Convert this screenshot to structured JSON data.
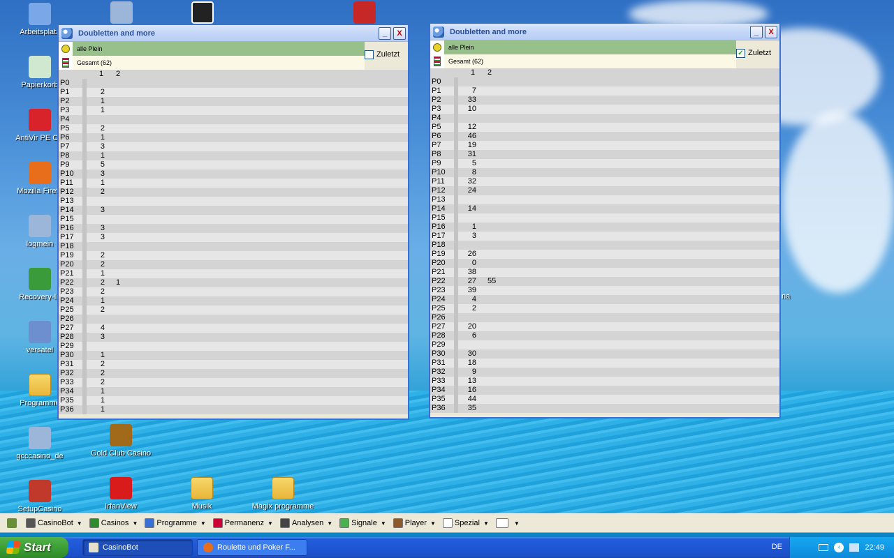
{
  "desktop": {
    "icons_left": [
      {
        "label": "Arbeitsplatz",
        "color": "#7aa7e8"
      },
      {
        "label": "Papierkorb",
        "color": "#cfe8cf"
      },
      {
        "label": "AntiVir PE Cla",
        "color": "#d8232a"
      },
      {
        "label": "Mozilla Firefo",
        "color": "#e86e1c"
      },
      {
        "label": "logmein",
        "color": "#9bb6d8"
      },
      {
        "label": "Recovery-In",
        "color": "#3a9b3a"
      },
      {
        "label": "versatel",
        "color": "#6d8fd0"
      },
      {
        "label": "Programme",
        "color": "folder"
      },
      {
        "label": "gcccasino_de",
        "color": "#9bb6d8"
      },
      {
        "label": "SetupCasino",
        "color": "#c0392b"
      }
    ],
    "icons_bottom": [
      {
        "label": "Gold Club Casino",
        "color": "#a06a1a"
      },
      {
        "label": "IrfanView",
        "color": "#d91b1b"
      },
      {
        "label": "Musik",
        "color": "folder"
      },
      {
        "label": "Magix programme",
        "color": "folder"
      }
    ],
    "stray_label": "na"
  },
  "window_left": {
    "title": "Doubletten and more",
    "filter_label": "alle Plein",
    "total_label": "Gesamt  (62)",
    "checkbox_label": "Zuletzt",
    "checkbox_checked": false,
    "col_headers": [
      "1",
      "2"
    ],
    "rows": [
      [
        "P0",
        "",
        ""
      ],
      [
        "P1",
        "2",
        ""
      ],
      [
        "P2",
        "1",
        ""
      ],
      [
        "P3",
        "1",
        ""
      ],
      [
        "P4",
        "",
        ""
      ],
      [
        "P5",
        "2",
        ""
      ],
      [
        "P6",
        "1",
        ""
      ],
      [
        "P7",
        "3",
        ""
      ],
      [
        "P8",
        "1",
        ""
      ],
      [
        "P9",
        "5",
        ""
      ],
      [
        "P10",
        "3",
        ""
      ],
      [
        "P11",
        "1",
        ""
      ],
      [
        "P12",
        "2",
        ""
      ],
      [
        "P13",
        "",
        ""
      ],
      [
        "P14",
        "3",
        ""
      ],
      [
        "P15",
        "",
        ""
      ],
      [
        "P16",
        "3",
        ""
      ],
      [
        "P17",
        "3",
        ""
      ],
      [
        "P18",
        "",
        ""
      ],
      [
        "P19",
        "2",
        ""
      ],
      [
        "P20",
        "2",
        ""
      ],
      [
        "P21",
        "1",
        ""
      ],
      [
        "P22",
        "2",
        "1"
      ],
      [
        "P23",
        "2",
        ""
      ],
      [
        "P24",
        "1",
        ""
      ],
      [
        "P25",
        "2",
        ""
      ],
      [
        "P26",
        "",
        ""
      ],
      [
        "P27",
        "4",
        ""
      ],
      [
        "P28",
        "3",
        ""
      ],
      [
        "P29",
        "",
        ""
      ],
      [
        "P30",
        "1",
        ""
      ],
      [
        "P31",
        "2",
        ""
      ],
      [
        "P32",
        "2",
        ""
      ],
      [
        "P33",
        "2",
        ""
      ],
      [
        "P34",
        "1",
        ""
      ],
      [
        "P35",
        "1",
        ""
      ],
      [
        "P36",
        "1",
        ""
      ]
    ]
  },
  "window_right": {
    "title": "Doubletten and more",
    "filter_label": "alle Plein",
    "total_label": "Gesamt  (62)",
    "checkbox_label": "Zuletzt",
    "checkbox_checked": true,
    "col_headers": [
      "1",
      "2"
    ],
    "rows": [
      [
        "P0",
        "",
        ""
      ],
      [
        "P1",
        "7",
        ""
      ],
      [
        "P2",
        "33",
        ""
      ],
      [
        "P3",
        "10",
        ""
      ],
      [
        "P4",
        "",
        ""
      ],
      [
        "P5",
        "12",
        ""
      ],
      [
        "P6",
        "46",
        ""
      ],
      [
        "P7",
        "19",
        ""
      ],
      [
        "P8",
        "31",
        ""
      ],
      [
        "P9",
        "5",
        ""
      ],
      [
        "P10",
        "8",
        ""
      ],
      [
        "P11",
        "32",
        ""
      ],
      [
        "P12",
        "24",
        ""
      ],
      [
        "P13",
        "",
        ""
      ],
      [
        "P14",
        "14",
        ""
      ],
      [
        "P15",
        "",
        ""
      ],
      [
        "P16",
        "1",
        ""
      ],
      [
        "P17",
        "3",
        ""
      ],
      [
        "P18",
        "",
        ""
      ],
      [
        "P19",
        "26",
        ""
      ],
      [
        "P20",
        "0",
        ""
      ],
      [
        "P21",
        "38",
        ""
      ],
      [
        "P22",
        "27",
        "55"
      ],
      [
        "P23",
        "39",
        ""
      ],
      [
        "P24",
        "4",
        ""
      ],
      [
        "P25",
        "2",
        ""
      ],
      [
        "P26",
        "",
        ""
      ],
      [
        "P27",
        "20",
        ""
      ],
      [
        "P28",
        "6",
        ""
      ],
      [
        "P29",
        "",
        ""
      ],
      [
        "P30",
        "30",
        ""
      ],
      [
        "P31",
        "18",
        ""
      ],
      [
        "P32",
        "9",
        ""
      ],
      [
        "P33",
        "13",
        ""
      ],
      [
        "P34",
        "16",
        ""
      ],
      [
        "P35",
        "44",
        ""
      ],
      [
        "P36",
        "35",
        ""
      ]
    ]
  },
  "casinobot_bar": {
    "items": [
      {
        "label": "CasinoBot",
        "icon": "casinobot-icon"
      },
      {
        "label": "Casinos",
        "icon": "dollar-icon"
      },
      {
        "label": "Programme",
        "icon": "window-icon"
      },
      {
        "label": "Permanenz",
        "icon": "stack-icon"
      },
      {
        "label": "Analysen",
        "icon": "chart-icon"
      },
      {
        "label": "Signale",
        "icon": "signal-icon"
      },
      {
        "label": "Player",
        "icon": "person-icon"
      },
      {
        "label": "Spezial",
        "icon": "blank-icon"
      }
    ]
  },
  "taskbar": {
    "start_label": "Start",
    "tasks": [
      {
        "label": "CasinoBot",
        "active": true
      },
      {
        "label": "Roulette und Poker F...",
        "active": false
      }
    ],
    "language": "DE",
    "clock": "22:49"
  }
}
